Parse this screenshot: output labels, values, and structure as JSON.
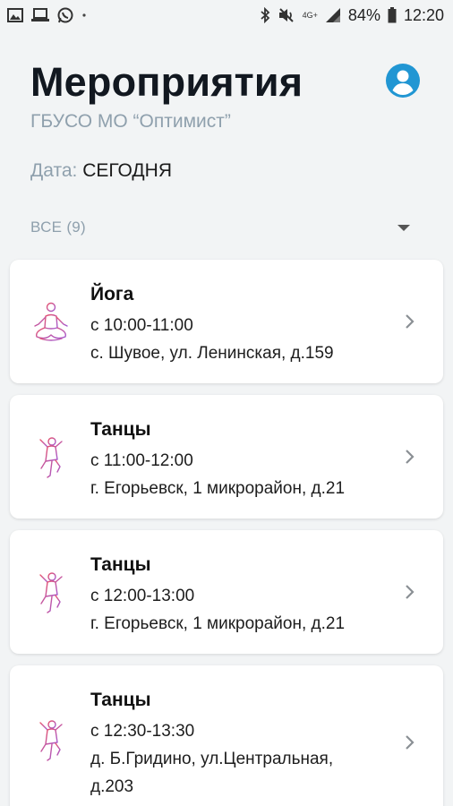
{
  "status_bar": {
    "battery": "84%",
    "time": "12:20",
    "network": "4G+"
  },
  "header": {
    "title": "Мероприятия",
    "subtitle": "ГБУСО МО “Оптимист”"
  },
  "date_filter": {
    "label": "Дата:",
    "value": "СЕГОДНЯ"
  },
  "category_filter": {
    "label": "ВСЕ (9)"
  },
  "events": [
    {
      "title": "Йога",
      "time": "с 10:00-11:00",
      "address": "с. Шувое, ул. Ленинская, д.159",
      "icon": "yoga-icon"
    },
    {
      "title": "Танцы",
      "time": "с 11:00-12:00",
      "address": "г. Егорьевск, 1 микрорайон, д.21",
      "icon": "dance-icon"
    },
    {
      "title": "Танцы",
      "time": "с 12:00-13:00",
      "address": "г. Егорьевск, 1 микрорайон, д.21",
      "icon": "dance-icon"
    },
    {
      "title": "Танцы",
      "time": "с 12:30-13:30",
      "address": "д. Б.Гридино, ул.Центральная,",
      "address2": "д.203",
      "icon": "dance-icon"
    }
  ],
  "colors": {
    "accent": "#2196d3",
    "muted": "#8fa0ad",
    "icon_gradient_start": "#e8526a",
    "icon_gradient_end": "#a35bd3"
  }
}
